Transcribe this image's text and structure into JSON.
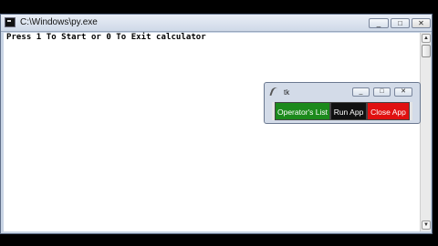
{
  "console": {
    "title": "C:\\Windows\\py.exe",
    "output_text": "Press 1 To Start or 0 To Exit calculator",
    "controls": {
      "minimize": "_",
      "maximize": "□",
      "close": "✕"
    },
    "scroll_up": "▲",
    "scroll_down": "▼"
  },
  "tk": {
    "title": "tk",
    "controls": {
      "minimize": "_",
      "maximize": "□",
      "close": "✕"
    },
    "buttons": [
      {
        "label": "Operator's List",
        "color": "#1c8a1c"
      },
      {
        "label": "Run App",
        "color": "#111111"
      },
      {
        "label": "Close App",
        "color": "#e01010"
      }
    ]
  }
}
